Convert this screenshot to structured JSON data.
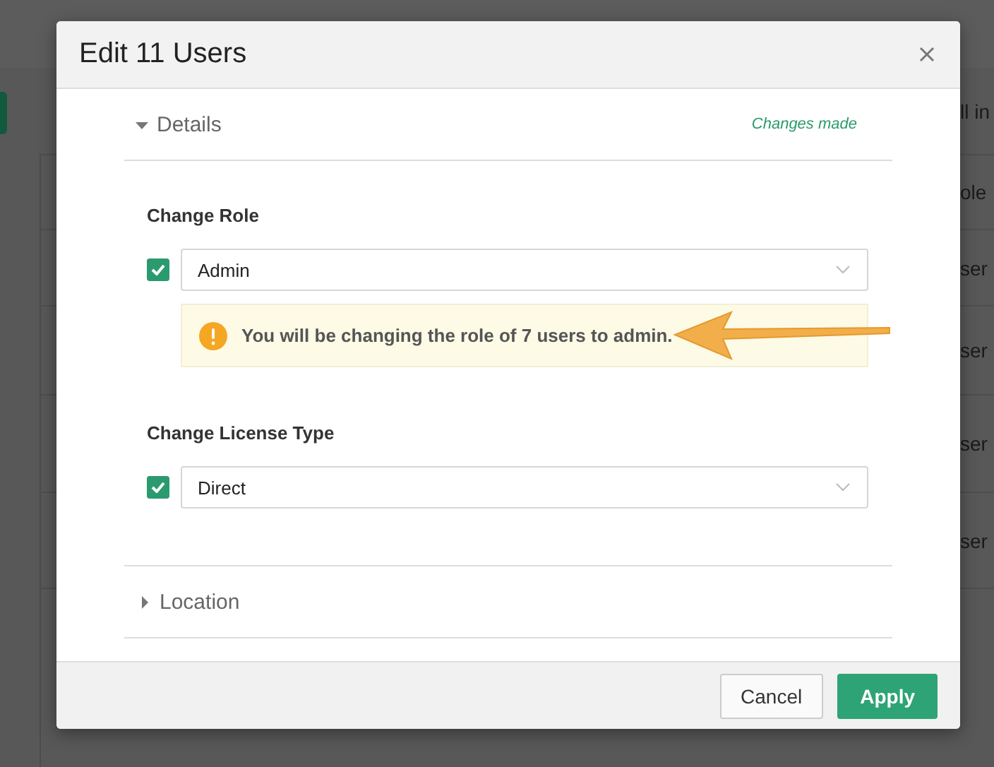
{
  "background": {
    "rows": [
      {
        "text": "ll in"
      },
      {
        "text": "ole"
      },
      {
        "text": "ser"
      },
      {
        "text": "ser"
      },
      {
        "text": "ser"
      },
      {
        "text": "ser"
      }
    ]
  },
  "dialog": {
    "title": "Edit 11 Users",
    "sections": [
      {
        "title": "Details",
        "expanded": true,
        "status": "Changes made",
        "fields": [
          {
            "label": "Change Role",
            "checked": true,
            "value": "Admin",
            "warning": "You will be changing the role of 7 users to admin."
          },
          {
            "label": "Change License Type",
            "checked": true,
            "value": "Direct"
          }
        ]
      },
      {
        "title": "Location",
        "expanded": false
      }
    ],
    "buttons": [
      {
        "label": "Cancel",
        "kind": "secondary"
      },
      {
        "label": "Apply",
        "kind": "primary"
      }
    ]
  }
}
